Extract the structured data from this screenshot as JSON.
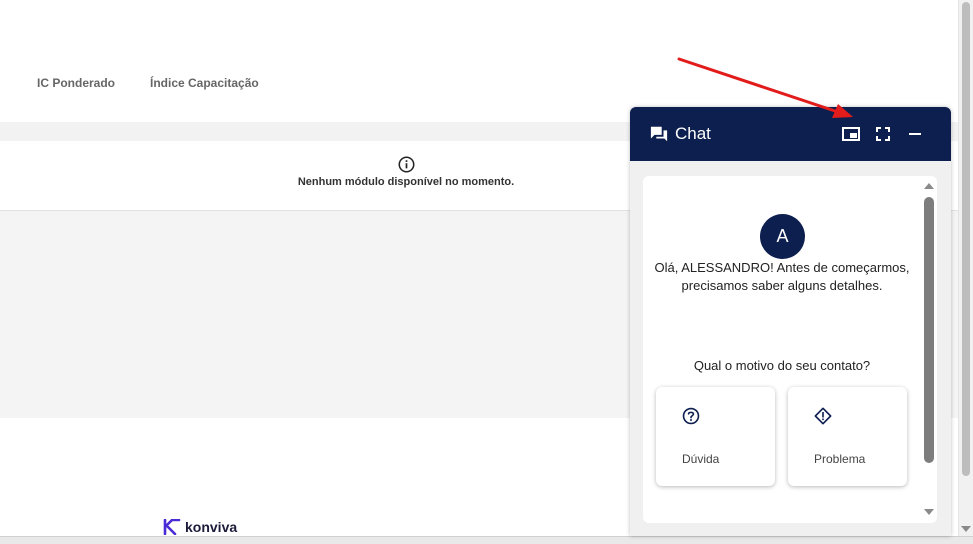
{
  "tabs": [
    {
      "label": "IC Ponderado"
    },
    {
      "label": "Índice Capacitação"
    }
  ],
  "modules": {
    "empty_message": "Nenhum módulo disponível no momento.",
    "icon": "info-icon"
  },
  "brand": {
    "name": "konviva",
    "logo_icon": "konviva-logo-icon"
  },
  "chat": {
    "title": "Chat",
    "header_icon": "chat-bubbles-icon",
    "controls": [
      "picture-in-picture-icon",
      "fullscreen-icon",
      "minimize-icon"
    ],
    "avatar_letter": "A",
    "greeting": "Olá, ALESSANDRO! Antes de começarmos, precisamos saber alguns detalhes.",
    "question": "Qual o motivo do seu contato?",
    "options": [
      {
        "label": "Dúvida",
        "icon": "question-circle-icon"
      },
      {
        "label": "Problema",
        "icon": "warning-diamond-icon"
      }
    ]
  },
  "colors": {
    "chat_header": "#0d1f4f",
    "annotation_arrow": "#e21b1b",
    "brand": "#4b2bd6"
  }
}
